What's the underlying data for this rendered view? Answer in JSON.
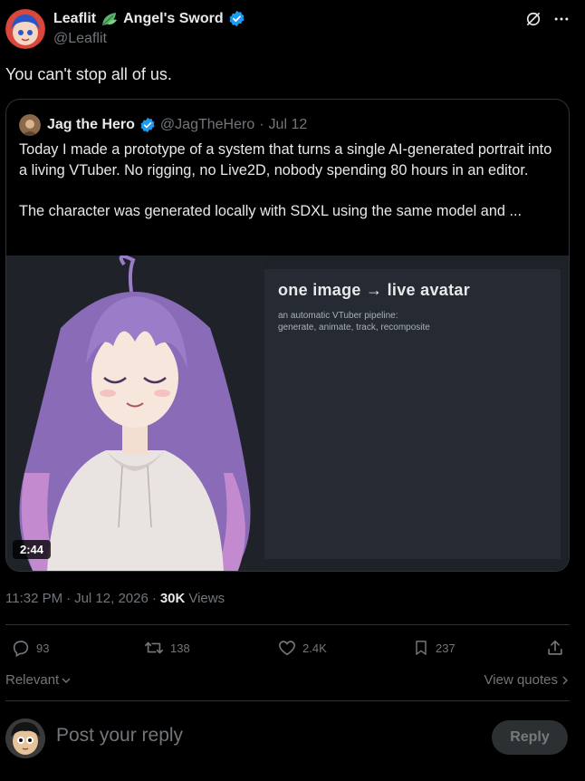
{
  "author": {
    "display_name": "Leaflit",
    "display_name_suffix": "Angel's Sword",
    "handle": "@Leaflit",
    "verified": true
  },
  "post": {
    "text": "You can't stop all of us."
  },
  "quote": {
    "display_name": "Jag the Hero",
    "handle": "@JagTheHero",
    "separator": "·",
    "date": "Jul 12",
    "body": "Today I made a prototype of a system that turns a single AI-generated portrait into a living VTuber. No rigging, no Live2D, nobody spending 80 hours in an editor.\n\nThe character was generated locally with SDXL using the same model and ...",
    "media": {
      "panel_title": "one image  →  live avatar",
      "panel_subtitle": "an automatic VTuber pipeline:\ngenerate, animate, track, recomposite",
      "duration": "2:44"
    }
  },
  "meta": {
    "time": "11:32 PM",
    "separator": "·",
    "date": "Jul 12, 2026",
    "separator2": "·",
    "views_count": "30K",
    "views_label": "Views"
  },
  "actions": {
    "replies": "93",
    "reposts": "138",
    "likes": "2.4K",
    "bookmarks": "237"
  },
  "sort": {
    "label": "Relevant",
    "view_quotes": "View quotes"
  },
  "reply": {
    "placeholder": "Post your reply",
    "button": "Reply"
  },
  "colors": {
    "background": "#000000",
    "text": "#e7e9ea",
    "muted": "#71767b",
    "border": "#2f3336",
    "verified": "#1d9bf0"
  }
}
